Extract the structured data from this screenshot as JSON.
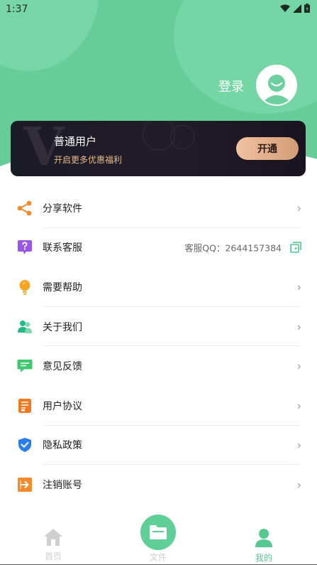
{
  "status_bar": {
    "time": "1:37"
  },
  "header": {
    "login_label": "登录"
  },
  "vip": {
    "title": "普通用户",
    "subtitle": "开启更多优惠福利",
    "open_label": "开通"
  },
  "menu": [
    {
      "label": "分享软件",
      "icon": "share-icon",
      "color": "#f08a2c"
    },
    {
      "label": "联系客服",
      "icon": "question-icon",
      "color": "#9a55e6",
      "extra": "客服QQ：2644157384"
    },
    {
      "label": "需要帮助",
      "icon": "bulb-icon",
      "color": "#f5a623"
    },
    {
      "label": "关于我们",
      "icon": "users-icon",
      "color": "#27b884"
    },
    {
      "label": "意见反馈",
      "icon": "chat-icon",
      "color": "#41c76e"
    },
    {
      "label": "用户协议",
      "icon": "document-icon",
      "color": "#f07a22"
    },
    {
      "label": "隐私政策",
      "icon": "shield-icon",
      "color": "#2b7de9"
    },
    {
      "label": "注销账号",
      "icon": "exit-icon",
      "color": "#f08a2c"
    }
  ],
  "nav": {
    "home": "首页",
    "files": "文件",
    "mine": "我的"
  },
  "colors": {
    "brand": "#66cc98",
    "active": "#57c990",
    "inactive": "#cfcfcf"
  }
}
